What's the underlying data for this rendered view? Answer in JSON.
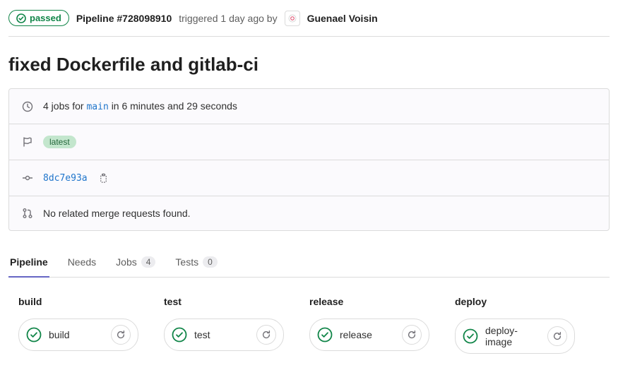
{
  "header": {
    "status_label": "passed",
    "pipeline_id": "Pipeline #728098910",
    "triggered_text": "triggered 1 day ago by",
    "user_name": "Guenael Voisin"
  },
  "commit_title": "fixed Dockerfile and gitlab-ci",
  "info": {
    "jobs_prefix": "4 jobs for",
    "branch": "main",
    "duration_text": "in 6 minutes and 29 seconds",
    "latest_tag": "latest",
    "commit_sha": "8dc7e93a",
    "mr_text": "No related merge requests found."
  },
  "tabs": {
    "pipeline": "Pipeline",
    "needs": "Needs",
    "jobs": "Jobs",
    "jobs_count": "4",
    "tests": "Tests",
    "tests_count": "0"
  },
  "stages": [
    {
      "name": "build",
      "job": "build"
    },
    {
      "name": "test",
      "job": "test"
    },
    {
      "name": "release",
      "job": "release"
    },
    {
      "name": "deploy",
      "job": "deploy-image"
    }
  ]
}
